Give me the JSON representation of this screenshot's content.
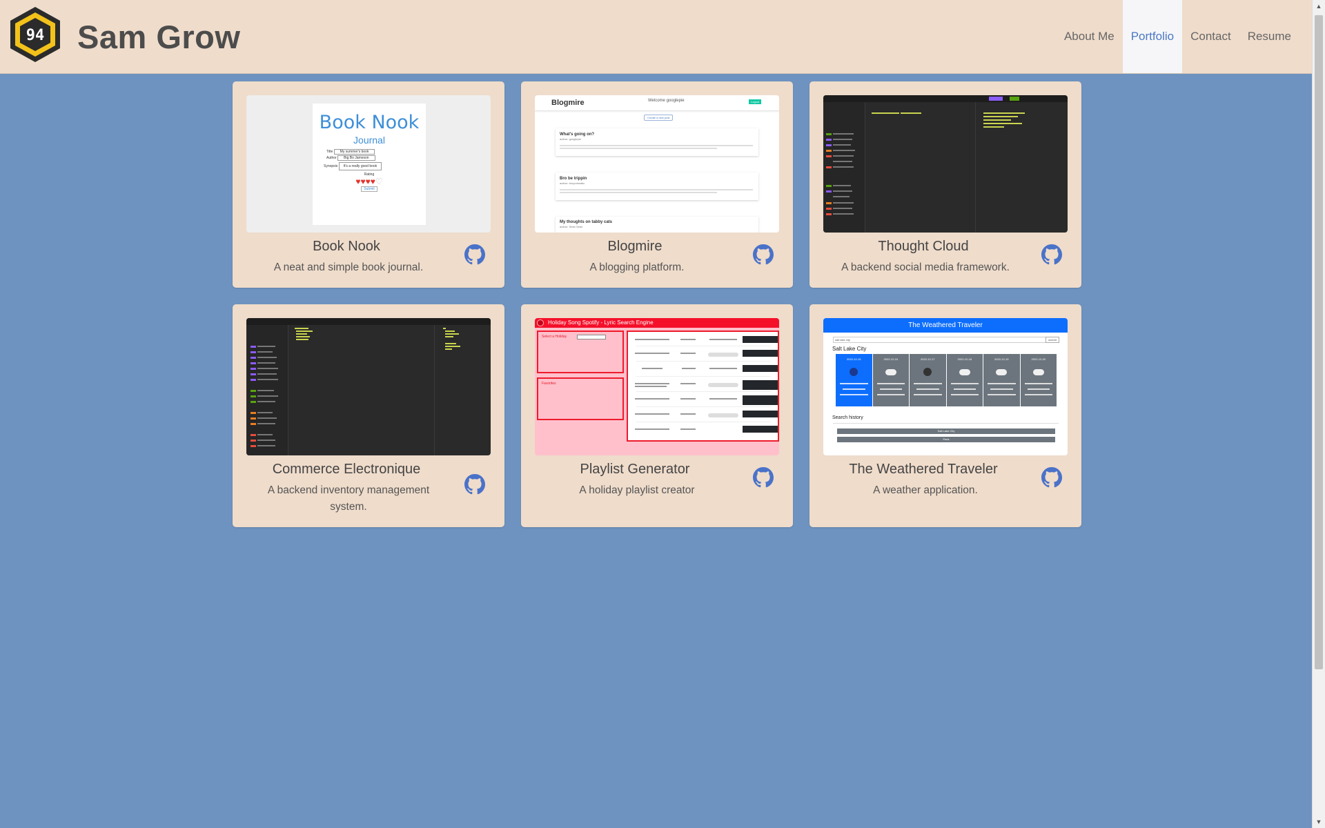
{
  "header": {
    "title": "Sam Grow",
    "logo_text": "94",
    "nav": [
      {
        "label": "About Me",
        "active": false
      },
      {
        "label": "Portfolio",
        "active": true
      },
      {
        "label": "Contact",
        "active": false
      },
      {
        "label": "Resume",
        "active": false
      }
    ]
  },
  "projects": [
    {
      "title": "Book Nook",
      "description": "A neat and simple book journal.",
      "thumb": {
        "heading": "Book Nook",
        "subheading": "Journal",
        "field1": "Title",
        "field1_value": "My summer's book",
        "field2": "Author",
        "field2_value": "Big Bo Jameson",
        "field3": "Synopsis",
        "field3_value": "It's a really good book",
        "rating": "Rating",
        "submit": "Submit"
      }
    },
    {
      "title": "Blogmire",
      "description": "A blogging platform.",
      "thumb": {
        "brand": "Blogmire",
        "welcome": "Welcome googlepie",
        "logout": "Logout",
        "create": "Create a new post",
        "posts": [
          {
            "title": "What's going on?",
            "author": "author: googlepie"
          },
          {
            "title": "Bro be trippin",
            "author": "author: broyonimatic"
          },
          {
            "title": "My thoughts on tabby cats",
            "author": "author: Sean Sean"
          }
        ]
      }
    },
    {
      "title": "Thought Cloud",
      "description": "A backend social media framework."
    },
    {
      "title": "Commerce Electronique",
      "description": "A backend inventory management system."
    },
    {
      "title": "Playlist Generator",
      "description": "A holiday playlist creator",
      "thumb": {
        "banner": "Holiday Song Spotify - Lyric Search Engine",
        "select_label": "Select a Holiday",
        "favorites_label": "Favorites"
      }
    },
    {
      "title": "The Weathered Traveler",
      "description": "A weather application.",
      "thumb": {
        "banner": "The Weathered Traveler",
        "search_value": "salt lake city",
        "search_button": "submit",
        "city": "Salt Lake City",
        "dates": [
          "2022-12-15",
          "2022-12-16",
          "2022-12-17",
          "2022-12-18",
          "2022-12-19",
          "2022-12-20"
        ],
        "history_label": "Search history",
        "history": [
          "Salt Lake City",
          "Paris"
        ]
      }
    }
  ],
  "colors": {
    "page_bg": "#6e93c0",
    "card_bg": "#efdccb",
    "nav_active": "#4a78c4",
    "github_icon": "#4a72c9"
  }
}
